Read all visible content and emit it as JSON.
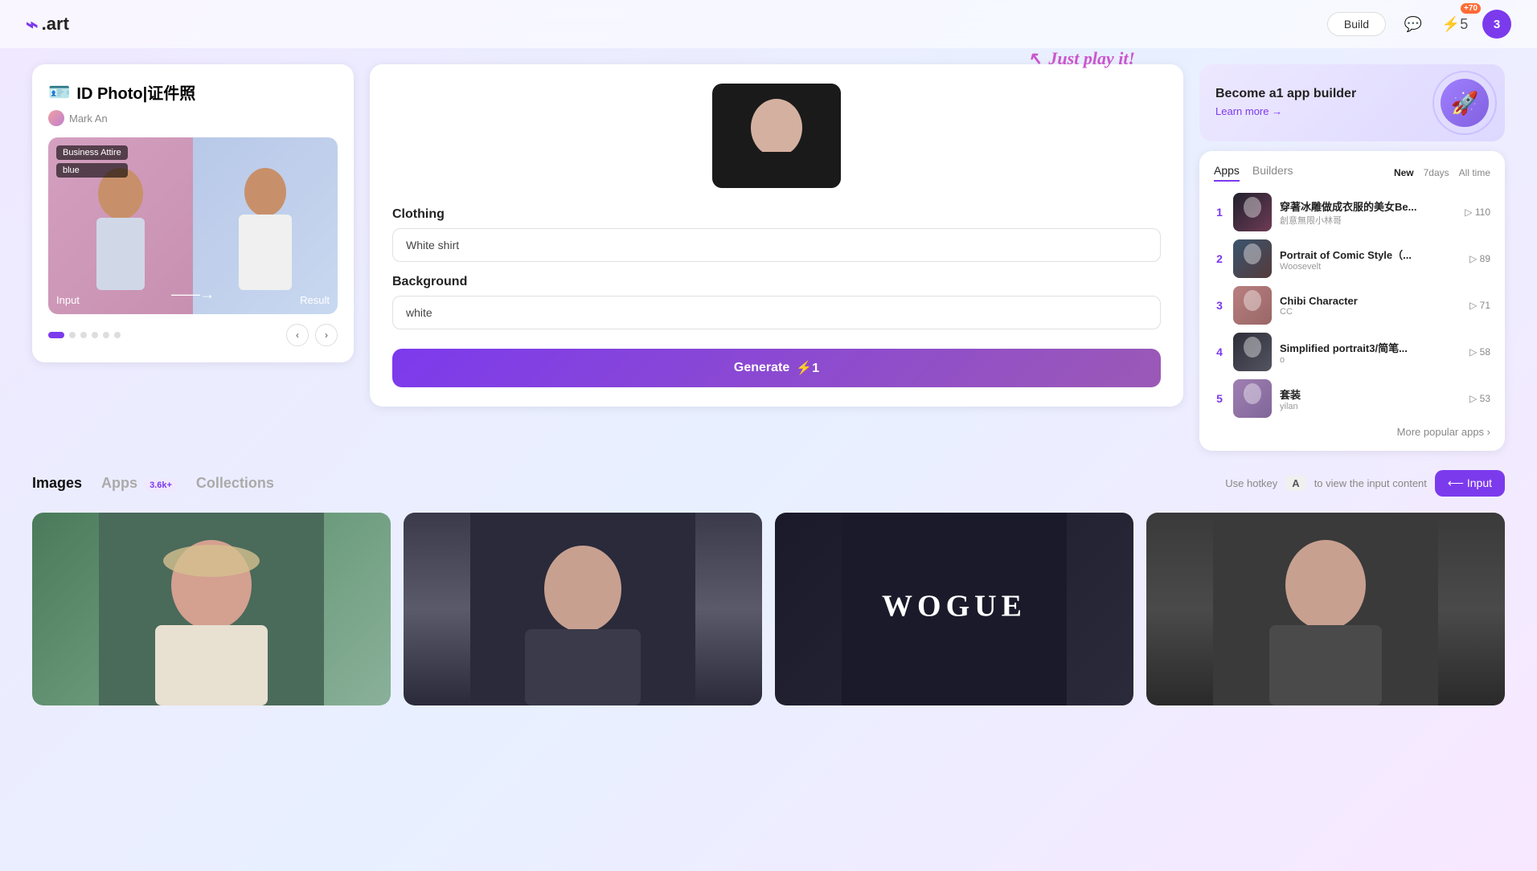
{
  "header": {
    "logo": ".art",
    "logo_symbol": "A",
    "build_label": "Build",
    "notification_count": "+70",
    "lightning_count": "5",
    "avatar_label": "3"
  },
  "app_card": {
    "emoji": "🪪",
    "title": "ID Photo|证件照",
    "author": "Mark An",
    "tag1": "Business Attire",
    "tag2": "blue",
    "input_label": "Input",
    "result_label": "Result"
  },
  "middle_card": {
    "just_play_it": "Just play it!",
    "clothing_label": "Clothing",
    "clothing_value": "White shirt",
    "clothing_placeholder": "White shirt",
    "background_label": "Background",
    "background_value": "white",
    "background_placeholder": "white",
    "generate_label": "Generate",
    "generate_cost": "⚡1"
  },
  "become_builder": {
    "title": "Become a1 app builder",
    "link": "Learn more →"
  },
  "popular_panel": {
    "tabs": [
      "Apps",
      "Builders"
    ],
    "active_tab": "Apps",
    "time_tabs": [
      "New",
      "7days",
      "All time"
    ],
    "active_time_tab": "New",
    "items": [
      {
        "rank": "1",
        "name": "穿著冰雕做成衣服的美女Be...",
        "author": "創意無限小林哥",
        "count": "110",
        "thumb_class": "thumb-1"
      },
      {
        "rank": "2",
        "name": "Portrait of Comic Style（...",
        "author": "Woosevelt",
        "count": "89",
        "thumb_class": "thumb-2"
      },
      {
        "rank": "3",
        "name": "Chibi Character",
        "author": "CC",
        "count": "71",
        "thumb_class": "thumb-3"
      },
      {
        "rank": "4",
        "name": "Simplified portrait3/简笔...",
        "author": "o",
        "count": "58",
        "thumb_class": "thumb-4"
      },
      {
        "rank": "5",
        "name": "套装",
        "author": "yilan",
        "count": "53",
        "thumb_class": "thumb-5"
      }
    ],
    "more_label": "More popular apps ›"
  },
  "bottom_tabs": {
    "images": "Images",
    "apps": "Apps",
    "apps_count": "3.6k+",
    "collections": "Collections",
    "active_tab": "Images"
  },
  "hotkey_section": {
    "label": "Use hotkey",
    "key": "A",
    "suffix": "to view the input content",
    "button_label": "⟵ Input"
  },
  "image_grid": {
    "vogue_text": "WOGUE"
  }
}
